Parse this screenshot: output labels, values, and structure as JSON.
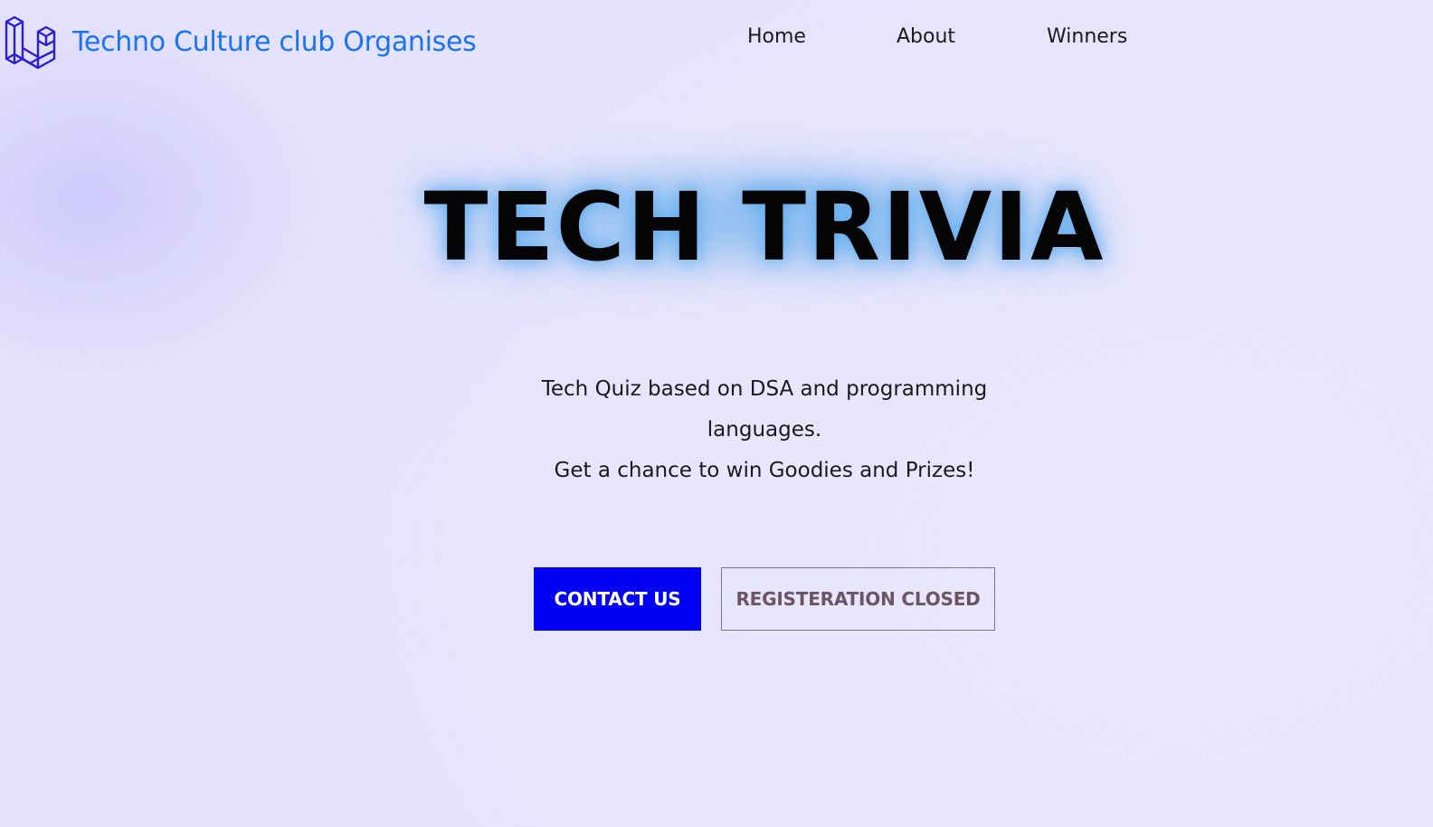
{
  "brand": {
    "logo_icon": "laravel-cube-logo-icon",
    "title": "Techno Culture club Organises",
    "color": "#1a73f0"
  },
  "nav": {
    "items": [
      {
        "label": "Home"
      },
      {
        "label": "About"
      },
      {
        "label": "Winners"
      }
    ]
  },
  "hero": {
    "title": "TECH TRIVIA",
    "description_line1": "Tech Quiz based on DSA and programming languages.",
    "description_line2": "Get a chance to win Goodies and Prizes!",
    "glow_color": "#78b4f0"
  },
  "buttons": {
    "contact_label": "CONTACT US",
    "contact_color": "#0000f5",
    "register_label": "REGISTERATION CLOSED",
    "register_text_color": "#6b5563"
  }
}
